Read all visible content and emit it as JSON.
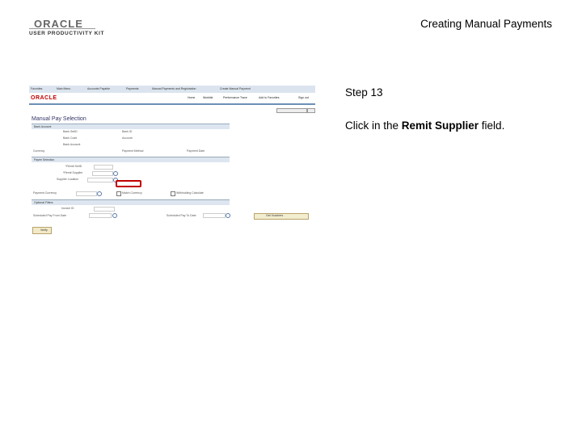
{
  "header": {
    "logo_oracle": "ORACLE",
    "logo_upk": "USER PRODUCTIVITY KIT",
    "title": "Creating Manual Payments"
  },
  "step": {
    "number": "Step 13",
    "instruction_prefix": "Click in the ",
    "instruction_bold": "Remit Supplier",
    "instruction_suffix": " field."
  },
  "screenshot": {
    "nav": [
      "Favorites",
      "Main Menu",
      "Accounts Payable",
      "Payments",
      "Manual Payments and Registration",
      "Create Manual Payment"
    ],
    "logo": "ORACLE",
    "top_menu": [
      "Home",
      "Worklist",
      "Performance Trace",
      "Add to Favorites",
      "Sign out"
    ],
    "page_title": "Manual Pay Selection",
    "sections": {
      "bank_account": "Bank Account",
      "payee_selection": "Payee Selection",
      "optional_filters": "Optional Filters"
    },
    "labels": {
      "bank_sets": "Bank SetID",
      "bank_id": "Bank ID",
      "bank_code": "Bank Code",
      "account": "Account",
      "bank_account": "Bank Account",
      "currency": "Currency",
      "payment_method": "Payment Method",
      "payment_date": "Payment Date",
      "remit_setid": "*Remit SetID",
      "remit_supplier": "*Remit Supplier",
      "location": "Supplier Location",
      "payment_currency": "Payment Currency",
      "match_currency": "Match Currency",
      "withholding": "Withholding Calculate",
      "invoice_id": "Invoice ID",
      "scheduled_from": "Scheduled Pay From Date",
      "scheduled_to": "Scheduled Pay To Date"
    },
    "buttons": {
      "ok": "Verify",
      "retrieve": "Get Vouchers"
    }
  }
}
